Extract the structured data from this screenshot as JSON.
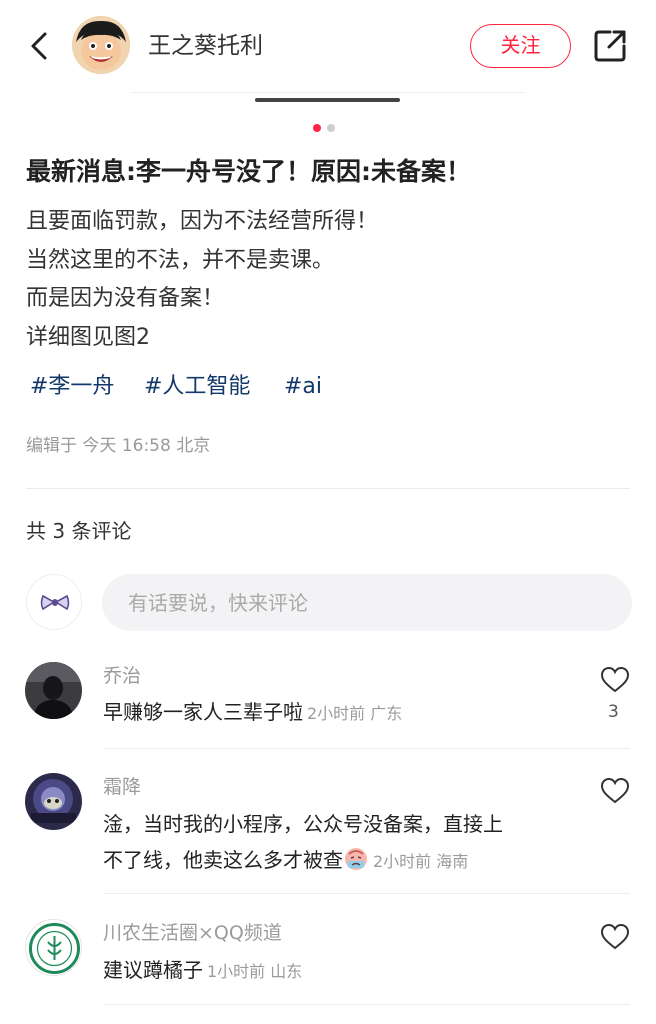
{
  "header": {
    "back_icon": "chevron-left-icon",
    "author_name": "王之葵托利",
    "follow_label": "关注",
    "share_icon": "share-external-icon"
  },
  "carousel": {
    "total": 2,
    "active": 1
  },
  "post": {
    "title": "最新消息:李一舟号没了！原因:未备案！",
    "lines": [
      "且要面临罚款，因为不法经营所得！",
      "当然这里的不法，并不是卖课。",
      "而是因为没有备案！",
      "详细图见图2"
    ],
    "tags": [
      "#李一舟",
      "#人工智能",
      "#ai"
    ],
    "edit_info": "编辑于 今天 16:58 北京"
  },
  "comments_section": {
    "count_text": "共 3 条评论",
    "input_placeholder": "有话要说，快来评论"
  },
  "comments": [
    {
      "user": "乔治",
      "text": "早赚够一家人三辈子啦",
      "meta": "2小时前 广东",
      "likes": "3"
    },
    {
      "user": "霜降",
      "text_line1": "淦，当时我的小程序，公众号没备案，直接上",
      "text_line2": "不了线，他卖这么多才被查",
      "meta": "2小时前 海南",
      "likes": ""
    },
    {
      "user": "川农生活圈×QQ频道",
      "text": "建议蹲橘子",
      "meta": "1小时前 山东",
      "likes": ""
    }
  ],
  "colors": {
    "accent": "#ff2442",
    "tag": "#13386c",
    "muted": "#9b9b9b"
  }
}
